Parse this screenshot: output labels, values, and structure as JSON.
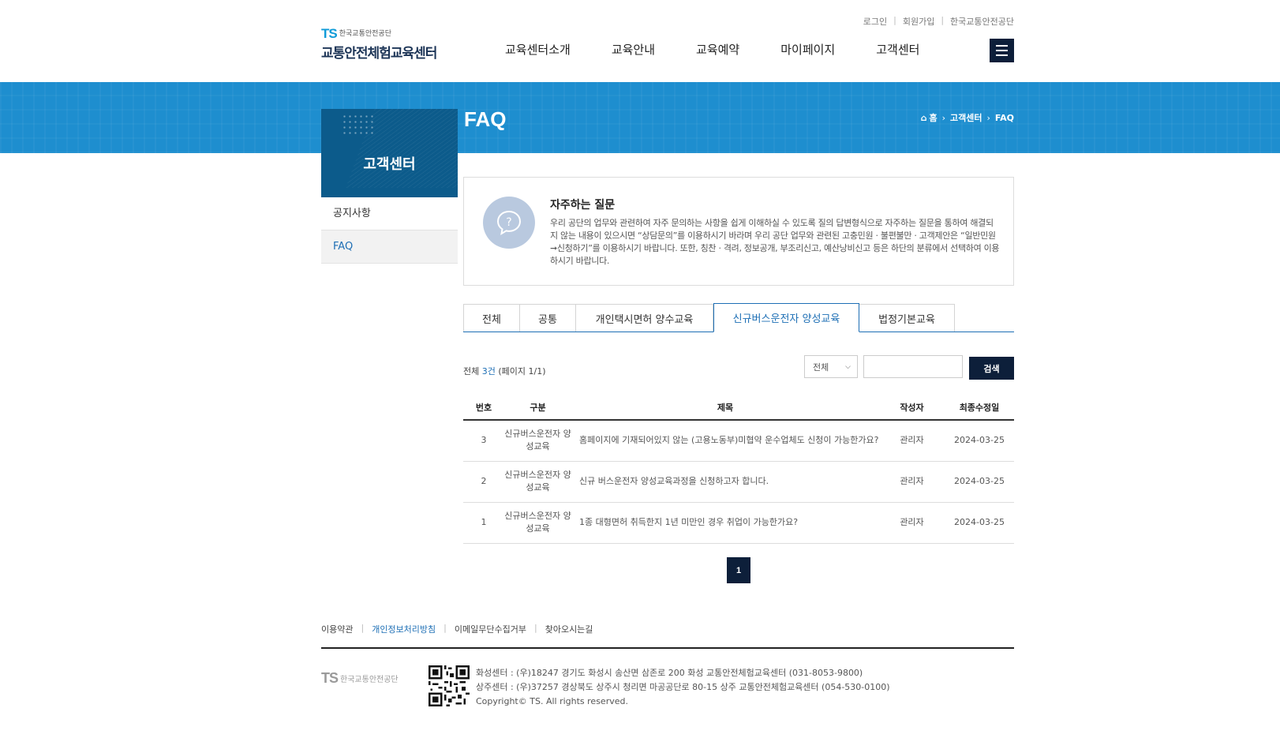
{
  "header": {
    "logo_ts": "TS",
    "logo_org": "한국교통안전공단",
    "logo_name": "교통안전체험교육센터",
    "util_links": [
      "로그인",
      "회원가입",
      "한국교통안전공단"
    ],
    "gnb": [
      "교육센터소개",
      "교육안내",
      "교육예약",
      "마이페이지",
      "고객센터"
    ],
    "menu_icon": "hamburger-icon"
  },
  "banner": {
    "title": "FAQ",
    "breadcrumb": [
      "홈",
      "고객센터",
      "FAQ"
    ],
    "home_icon": "home-icon",
    "color": "#1e8ecf"
  },
  "lnb": {
    "title": "고객센터",
    "items": [
      {
        "label": "공지사항"
      },
      {
        "label": "FAQ"
      }
    ]
  },
  "intro": {
    "icon": "question-bubble-icon",
    "title": "자주하는 질문",
    "text": "우리 공단의 업무와 관련하여 자주 문의하는 사항을 쉽게 이해하실 수 있도록 질의 답변형식으로 자주하는 질문을 통하여 해결되지 않는 내용이 있으시면 “상담문의”를 이용하시기 바라며 우리 공단 업무와 관련된 고충민원 · 불편불만 · 고객제안은 “일반민원➞신청하기”를 이용하시기 바랍니다. 또한, 칭찬 · 격려, 정보공개, 부조리신고, 예산낭비신고 등은 하단의 분류에서 선택하여 이용하시기 바랍니다."
  },
  "tabs": [
    "전체",
    "공통",
    "개인택시면허 양수교육",
    "신규버스운전자 양성교육",
    "법정기본교육"
  ],
  "active_tab_index": 3,
  "search": {
    "count_prefix": "전체 ",
    "count": "3건",
    "page_info": " (페이지 1/1)",
    "select_value": "전체",
    "keyword_value": "",
    "button": "검색"
  },
  "table": {
    "headers": [
      "번호",
      "구분",
      "제목",
      "작성자",
      "최종수정일"
    ],
    "rows": [
      {
        "no": "3",
        "category": "신규버스운전자 양성교육",
        "title": "홈페이지에 기재되어있지 않는 (고용노동부)미협약 운수업체도 신청이 가능한가요?",
        "author": "관리자",
        "date": "2024-03-25"
      },
      {
        "no": "2",
        "category": "신규버스운전자 양성교육",
        "title": "신규 버스운전자 양성교육과정을 신청하고자 합니다.",
        "author": "관리자",
        "date": "2024-03-25"
      },
      {
        "no": "1",
        "category": "신규버스운전자 양성교육",
        "title": "1종 대형면허 취득한지 1년 미만인 경우 취업이 가능한가요?",
        "author": "관리자",
        "date": "2024-03-25"
      }
    ]
  },
  "pagination": {
    "current": "1"
  },
  "footer": {
    "links": [
      "이용약관",
      "개인정보처리방침",
      "이메일무단수집거부",
      "찾아오시는길"
    ],
    "logo_ts": "TS",
    "logo_org": "한국교통안전공단",
    "address1": "화성센터 : (우)18247 경기도 화성시 송산면 삼존로 200 화성 교통안전체험교육센터 (031-8053-9800)",
    "address2": "상주센터 : (우)37257 경상북도 상주시 청리면 마공공단로 80-15 상주 교통안전체험교육센터 (054-530-0100)",
    "copyright": "Copyright© TS. All rights reserved."
  }
}
